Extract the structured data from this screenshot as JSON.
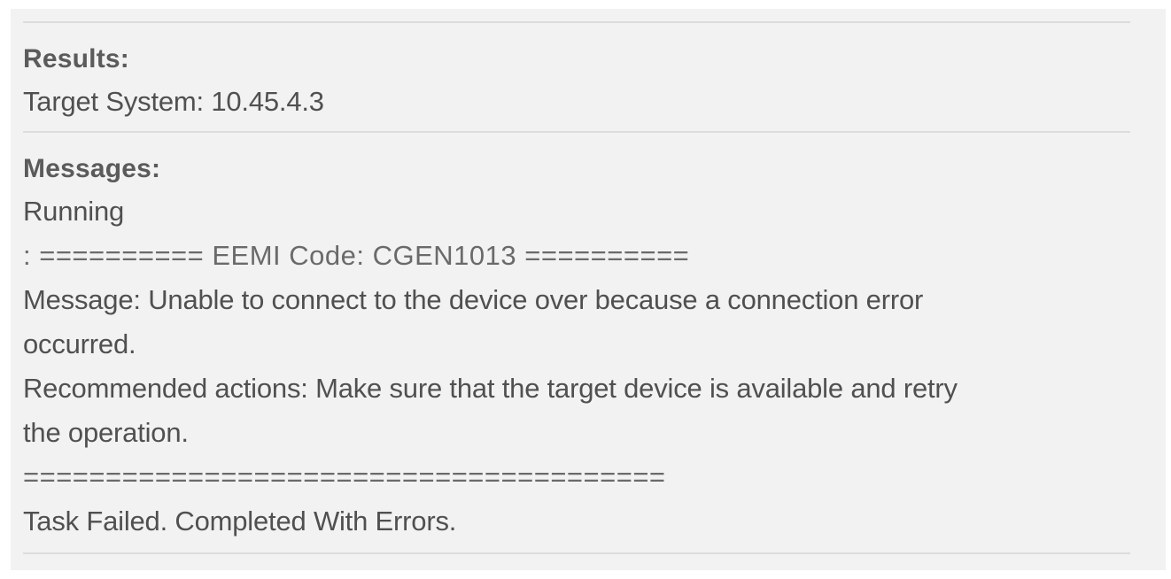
{
  "results": {
    "heading": "Results:",
    "target_system": "Target System: 10.45.4.3"
  },
  "messages": {
    "heading": "Messages:",
    "lines": [
      "Running",
      ": ========== EEMI Code: CGEN1013 ==========",
      "Message: Unable to connect to the device over because a connection error",
      "occurred.",
      "Recommended actions: Make sure that the target device is available and retry",
      "the operation.",
      "=======================================",
      "Task Failed. Completed With Errors."
    ]
  }
}
